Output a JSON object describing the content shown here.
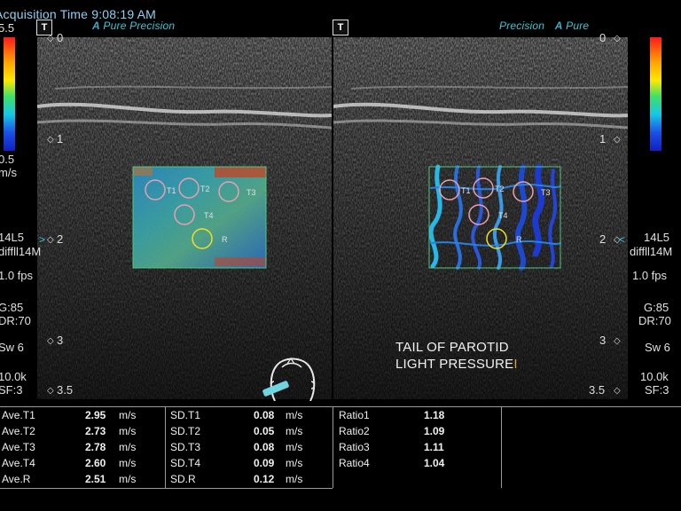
{
  "header": {
    "acquisition_time": "Acquisition Time 9:08:19 AM",
    "tag_left": "T",
    "tag_right": "T",
    "left_mode": {
      "a": "A",
      "pure": "Pure",
      "precision": "Precision"
    },
    "right_mode": {
      "precision": "Precision",
      "a": "A",
      "pure": "Pure"
    }
  },
  "scale": {
    "top_value": "5.5",
    "bottom_value": "0.5",
    "unit": "m/s"
  },
  "depth_ticks": [
    "0",
    "1",
    "2",
    "3",
    "3.5"
  ],
  "left_side": {
    "probe": "14L5",
    "preset": "diffll14M",
    "fps": "1.0 fps",
    "gain": "G:85",
    "dr": "DR:70",
    "sw": "Sw 6",
    "freq": "10.0k",
    "sf": "SF:3"
  },
  "right_side": {
    "probe": "14L5",
    "preset": "diffll14M",
    "fps": "1.0 fps",
    "gain": "G:85",
    "dr": "DR:70",
    "sw": "Sw 6",
    "freq": "10.0k",
    "sf": "SF:3"
  },
  "roi_labels": [
    "T1",
    "T2",
    "T3",
    "T4",
    "R"
  ],
  "annotation": {
    "line1": "TAIL OF PAROTID",
    "line2": "LIGHT PRESSURE"
  },
  "measurements": {
    "averages": [
      {
        "label": "Ave.T1",
        "value": "2.95",
        "unit": "m/s"
      },
      {
        "label": "Ave.T2",
        "value": "2.73",
        "unit": "m/s"
      },
      {
        "label": "Ave.T3",
        "value": "2.78",
        "unit": "m/s"
      },
      {
        "label": "Ave.T4",
        "value": "2.60",
        "unit": "m/s"
      },
      {
        "label": "Ave.R",
        "value": "2.51",
        "unit": "m/s"
      }
    ],
    "sds": [
      {
        "label": "SD.T1",
        "value": "0.08",
        "unit": "m/s"
      },
      {
        "label": "SD.T2",
        "value": "0.05",
        "unit": "m/s"
      },
      {
        "label": "SD.T3",
        "value": "0.08",
        "unit": "m/s"
      },
      {
        "label": "SD.T4",
        "value": "0.09",
        "unit": "m/s"
      },
      {
        "label": "SD.R",
        "value": "0.12",
        "unit": "m/s"
      }
    ],
    "ratios": [
      {
        "label": "Ratio1",
        "value": "1.18"
      },
      {
        "label": "Ratio2",
        "value": "1.09"
      },
      {
        "label": "Ratio3",
        "value": "1.11"
      },
      {
        "label": "Ratio4",
        "value": "1.04"
      }
    ]
  },
  "colors": {
    "roi_target": "#e8a0b0",
    "roi_reference": "#f0e020",
    "roi_box": "#50c880",
    "header_text": "#8fd0f2"
  }
}
